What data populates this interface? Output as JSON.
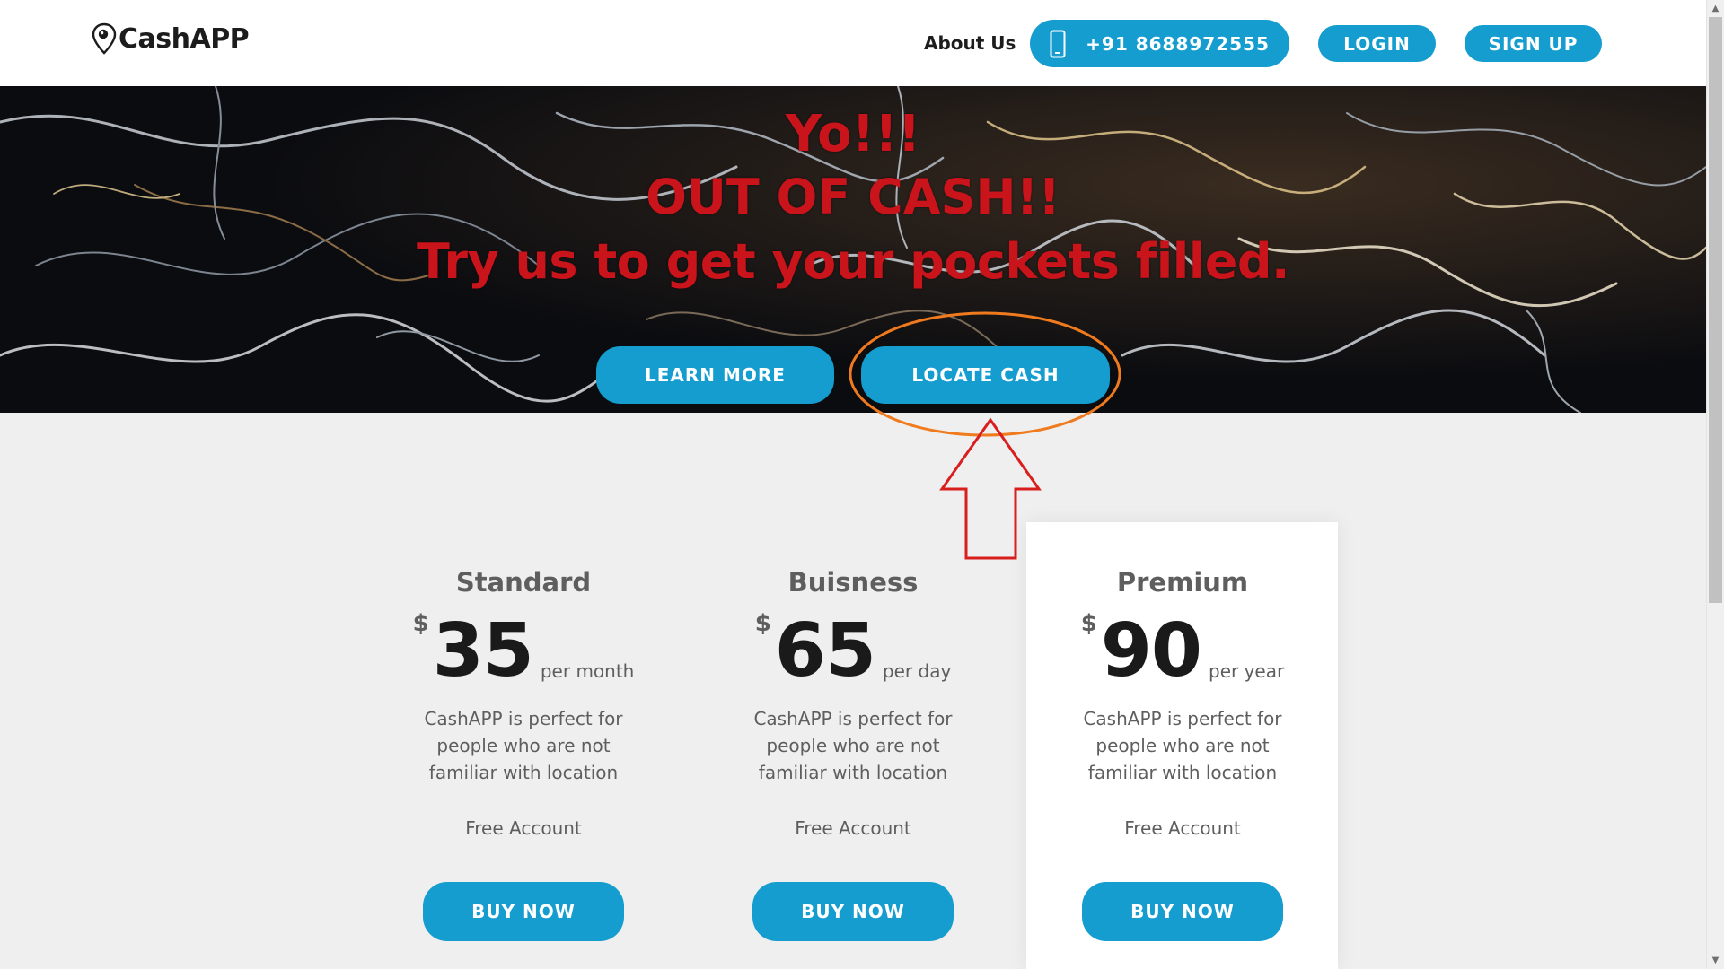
{
  "brand": {
    "name": "CashAPP",
    "accent_color": "#159dd0",
    "headline_color": "#c9141b"
  },
  "nav": {
    "about": "About Us",
    "phone": "+91 8688972555",
    "login": "LOGIN",
    "signup": "SIGN UP"
  },
  "hero": {
    "line1": "Yo!!!",
    "line2": "OUT OF CASH!!",
    "line3": "Try us to get your pockets filled.",
    "learn_more": "LEARN MORE",
    "locate_cash": "LOCATE CASH"
  },
  "annotation": {
    "highlight_target": "LOCATE CASH",
    "ellipse_color": "#f07a1e",
    "arrow_color": "#d91e1e"
  },
  "plans": [
    {
      "name": "Standard",
      "currency": "$",
      "amount": "35",
      "period": "per month",
      "description": "CashAPP is perfect for people who are not familiar with location",
      "feature": "Free Account",
      "button": "BUY NOW"
    },
    {
      "name": "Buisness",
      "currency": "$",
      "amount": "65",
      "period": "per day",
      "description": "CashAPP is perfect for people who are not familiar with location",
      "feature": "Free Account",
      "button": "BUY NOW"
    },
    {
      "name": "Premium",
      "currency": "$",
      "amount": "90",
      "period": "per year",
      "description": "CashAPP is perfect for people who are not familiar with location",
      "feature": "Free Account",
      "button": "BUY NOW",
      "highlighted": true
    }
  ]
}
